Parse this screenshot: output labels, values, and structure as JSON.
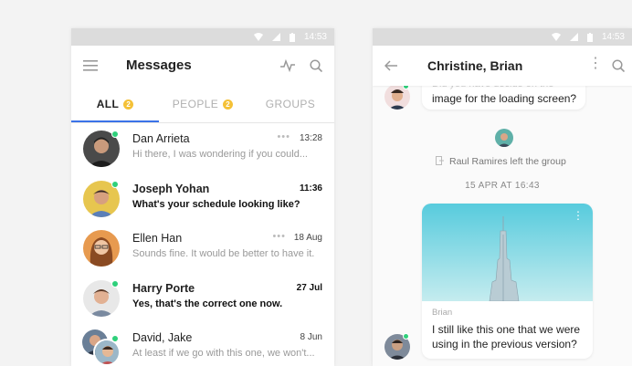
{
  "left_phone": {
    "status_time": "14:53",
    "title": "Messages",
    "tabs": [
      {
        "label": "ALL",
        "badge": "2"
      },
      {
        "label": "PEOPLE",
        "badge": "2"
      },
      {
        "label": "GROUPS"
      }
    ],
    "conversations": [
      {
        "name": "Dan Arrieta",
        "preview": "Hi there, I was wondering if you could...",
        "time": "13:28",
        "unread": false,
        "online": true
      },
      {
        "name": "Joseph Yohan",
        "preview": "What's your schedule looking like?",
        "time": "11:36",
        "unread": true,
        "online": true
      },
      {
        "name": "Ellen Han",
        "preview": "Sounds fine. It would be better to have it...",
        "time": "18 Aug",
        "unread": false,
        "online": false
      },
      {
        "name": "Harry Porte",
        "preview": "Yes, that's the correct one now.",
        "time": "27 Jul",
        "unread": true,
        "online": true
      },
      {
        "name": "David, Jake",
        "preview": "At least if we go with this one, we won't...",
        "time": "8 Jun",
        "unread": false,
        "online": true
      }
    ]
  },
  "right_phone": {
    "status_time": "14:53",
    "title": "Christine, Brian",
    "cutoff_text": "Did you have decide on the",
    "incoming_text": "image for the loading screen?",
    "system_event": "Raul Ramires left the group",
    "date_divider": "15 APR AT 16:43",
    "image_message": {
      "sender": "Brian",
      "text_line1": "I still like this one that we were",
      "text_line2": "using in the previous version?"
    }
  },
  "colors": {
    "accent": "#3b73e8",
    "badge": "#f4c137",
    "online": "#2fd07b",
    "status_bar": "#dcdcdc"
  }
}
